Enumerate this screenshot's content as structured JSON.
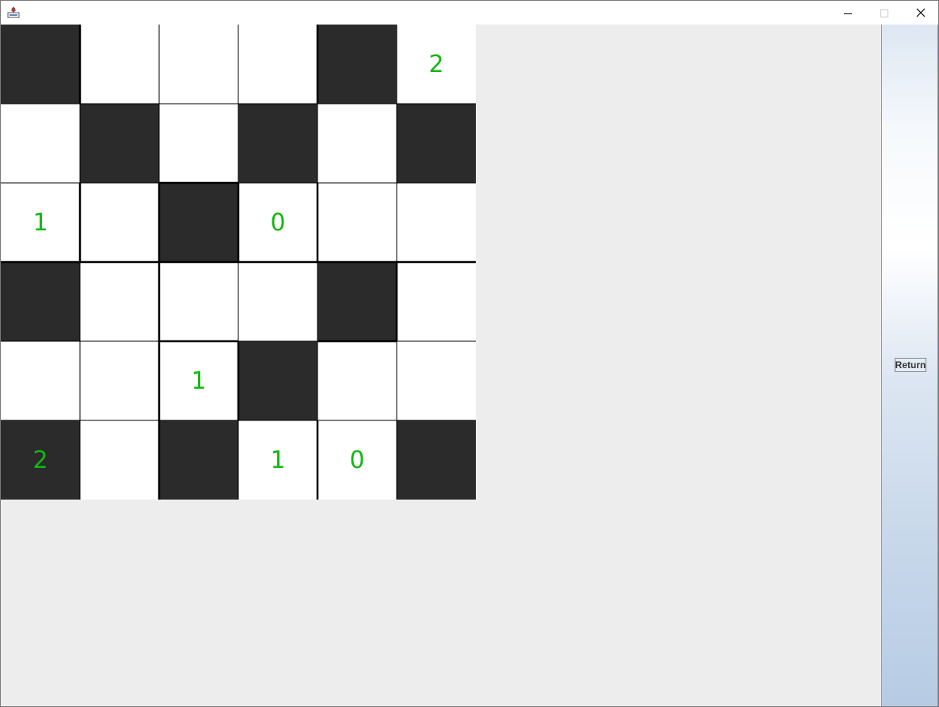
{
  "window": {
    "icons": {
      "app": "java-app-icon",
      "minimize": "minimize-icon",
      "maximize": "maximize-icon",
      "close": "close-icon"
    }
  },
  "board": {
    "rows": 6,
    "cols": 6,
    "colors": {
      "white_cell": "#ffffff",
      "black_cell": "#2b2b2b",
      "number": "#12b812"
    },
    "cells": [
      [
        {
          "color": "black",
          "value": ""
        },
        {
          "color": "white",
          "value": ""
        },
        {
          "color": "white",
          "value": ""
        },
        {
          "color": "white",
          "value": ""
        },
        {
          "color": "black",
          "value": ""
        },
        {
          "color": "white",
          "value": "2"
        }
      ],
      [
        {
          "color": "white",
          "value": ""
        },
        {
          "color": "black",
          "value": ""
        },
        {
          "color": "white",
          "value": ""
        },
        {
          "color": "black",
          "value": ""
        },
        {
          "color": "white",
          "value": ""
        },
        {
          "color": "black",
          "value": ""
        }
      ],
      [
        {
          "color": "white",
          "value": "1"
        },
        {
          "color": "white",
          "value": ""
        },
        {
          "color": "black",
          "value": ""
        },
        {
          "color": "white",
          "value": "0"
        },
        {
          "color": "white",
          "value": ""
        },
        {
          "color": "white",
          "value": ""
        }
      ],
      [
        {
          "color": "black",
          "value": ""
        },
        {
          "color": "white",
          "value": ""
        },
        {
          "color": "white",
          "value": ""
        },
        {
          "color": "white",
          "value": ""
        },
        {
          "color": "black",
          "value": ""
        },
        {
          "color": "white",
          "value": ""
        }
      ],
      [
        {
          "color": "white",
          "value": ""
        },
        {
          "color": "white",
          "value": ""
        },
        {
          "color": "white",
          "value": "1"
        },
        {
          "color": "black",
          "value": ""
        },
        {
          "color": "white",
          "value": ""
        },
        {
          "color": "white",
          "value": ""
        }
      ],
      [
        {
          "color": "black",
          "value": "2"
        },
        {
          "color": "white",
          "value": ""
        },
        {
          "color": "black",
          "value": ""
        },
        {
          "color": "white",
          "value": "1"
        },
        {
          "color": "white",
          "value": "0"
        },
        {
          "color": "black",
          "value": ""
        }
      ]
    ]
  },
  "side_panel": {
    "return_label": "Return"
  }
}
